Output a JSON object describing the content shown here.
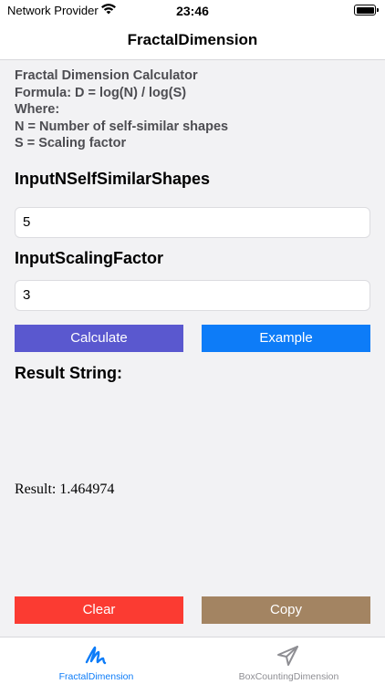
{
  "status_bar": {
    "carrier": "Network Provider",
    "time": "23:46",
    "icons": [
      "wifi-icon",
      "battery-icon"
    ]
  },
  "nav": {
    "title": "FractalDimension"
  },
  "info": {
    "line1": "Fractal Dimension Calculator",
    "line2": "Formula: D = log(N) / log(S)",
    "line3": "Where:",
    "line4": "N = Number of self-similar shapes",
    "line5": "S = Scaling factor"
  },
  "inputs": {
    "n_label": "InputNSelfSimilarShapes",
    "n_value": "5",
    "s_label": "InputScalingFactor",
    "s_value": "3"
  },
  "buttons": {
    "calculate": "Calculate",
    "example": "Example",
    "clear": "Clear",
    "copy": "Copy"
  },
  "result": {
    "heading": "Result String:",
    "text": "Result: 1.464974"
  },
  "tabs": [
    {
      "label": "FractalDimension",
      "icon": "scribble-icon",
      "selected": true
    },
    {
      "label": "BoxCountingDimension",
      "icon": "paper-plane-icon",
      "selected": false
    }
  ],
  "colors": {
    "calculate": "#5a58cf",
    "example": "#0d7cf8",
    "clear": "#fb3b32",
    "copy": "#a38462",
    "tab_selected": "#0d7cf8",
    "tab_unselected": "#8e8e93"
  }
}
